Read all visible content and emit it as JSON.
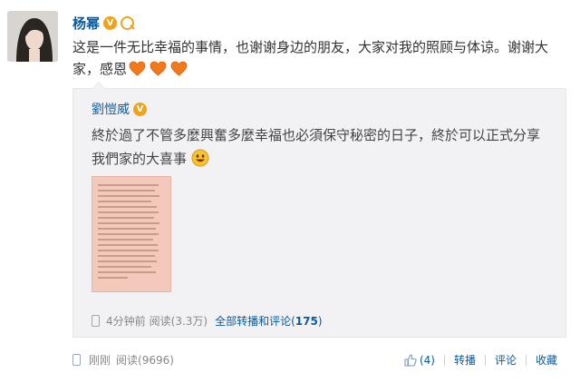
{
  "post": {
    "author": "杨幂",
    "text": "这是一件无比幸福的事情，也谢谢身边的朋友，大家对我的照顾与体谅。谢谢大家，感恩",
    "emoji": [
      "heart-icon",
      "heart-icon",
      "heart-icon"
    ]
  },
  "repost": {
    "author": "劉愷威",
    "text": "終於過了不管多麼興奮多麼幸福也必須保守秘密的日子，終於可以正式分享我們家的大喜事",
    "meta": {
      "time": "4分钟前",
      "reads": "阅读(3.3万)",
      "link_label": "全部转播和评论(",
      "link_count": "175",
      "link_close": ")"
    }
  },
  "footer": {
    "time": "刚刚",
    "reads": "阅读(9696)",
    "like_count": "(4)",
    "actions": [
      "转播",
      "评论",
      "收藏"
    ]
  },
  "colors": {
    "link": "#0a5a9c",
    "badge": "#f0a21b",
    "heart": "#f07a1c",
    "repost_bg": "#f2f2f5"
  }
}
